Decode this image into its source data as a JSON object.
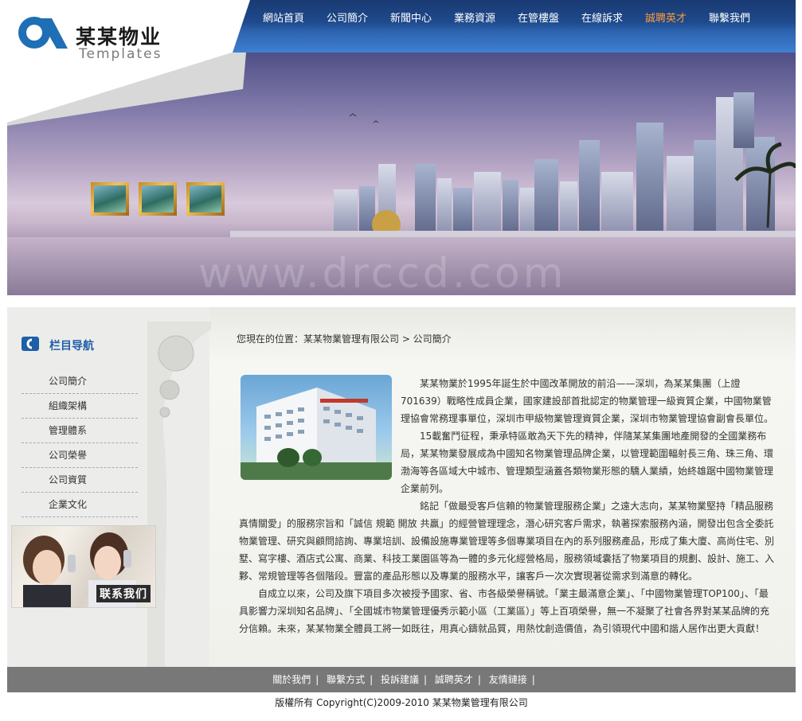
{
  "brand": {
    "name": "某某物业",
    "sub": "Templates"
  },
  "nav": {
    "items": [
      "網站首頁",
      "公司簡介",
      "新聞中心",
      "業務資源",
      "在管樓盤",
      "在線訴求",
      "誠聘英才",
      "聯繫我們"
    ],
    "active_index": 6,
    "active_color": "#ff9a3a"
  },
  "banner": {
    "watermark": "www.drccd.com"
  },
  "sidebar": {
    "title": "栏目导航",
    "items": [
      "公司簡介",
      "組織架構",
      "管理體系",
      "公司榮譽",
      "公司資質",
      "企業文化"
    ],
    "contact_label": "联系我们"
  },
  "main": {
    "breadcrumb": "您現在的位置：某某物業管理有限公司 > 公司簡介",
    "paragraphs": [
      "某某物業於1995年誕生於中國改革開放的前沿——深圳，為某某集團（上證701639）戰略性成員企業，國家建設部首批認定的物業管理一級資質企業，中國物業管理協會常務理事單位，深圳市甲級物業管理資質企業，深圳市物業管理協會副會長單位。",
      "15載奮鬥征程，秉承特區敢為天下先的精神，伴隨某某集團地產開發的全國業務布局，某某物業發展成為中國知名物業管理品牌企業，以管理範圍輻射長三角、珠三角、環渤海等各區域大中城市、管理類型涵蓋各類物業形態的驕人業績，始終雄踞中國物業管理企業前列。",
      "銘記「做最受客戶信賴的物業管理服務企業」之遠大志向，某某物業堅持「精品服務 真情關愛」的服務宗旨和「誠信 規範 開放 共贏」的經營管理理念，潛心研究客戶需求，執著探索服務內涵，開發出包含全委託物業管理、研究與顧問諮詢、專業培訓、設備設施專業管理等多個專業項目在內的系列服務產品，形成了集大廈、高尚住宅、別墅、寫字樓、酒店式公寓、商業、科技工業園區等為一體的多元化經營格局，服務領域囊括了物業項目的規劃、設計、施工、入夥、常規管理等各個階段。豐富的產品形態以及專業的服務水平，讓客戶一次次實現著從需求到滿意的轉化。",
      "自成立以來，公司及旗下項目多次被授予國家、省、市各級榮譽稱號。「業主最滿意企業」、「中國物業管理TOP100」、「最具影響力深圳知名品牌」、「全國城市物業管理優秀示範小區（工業區）」等上百項榮譽，無一不凝聚了社會各界對某某品牌的充分信賴。未來，某某物業全體員工將一如既往，用真心鑄就品質，用熱忱創造價值，為引領現代中國和諧人居作出更大貢獻！"
    ]
  },
  "footer": {
    "links": [
      "關於我們",
      "聯繫方式",
      "投訴建議",
      "誠聘英才",
      "友情鏈接"
    ],
    "separator": "|",
    "copyright": "版權所有 Copyright(C)2009-2010 某某物業管理有限公司"
  }
}
